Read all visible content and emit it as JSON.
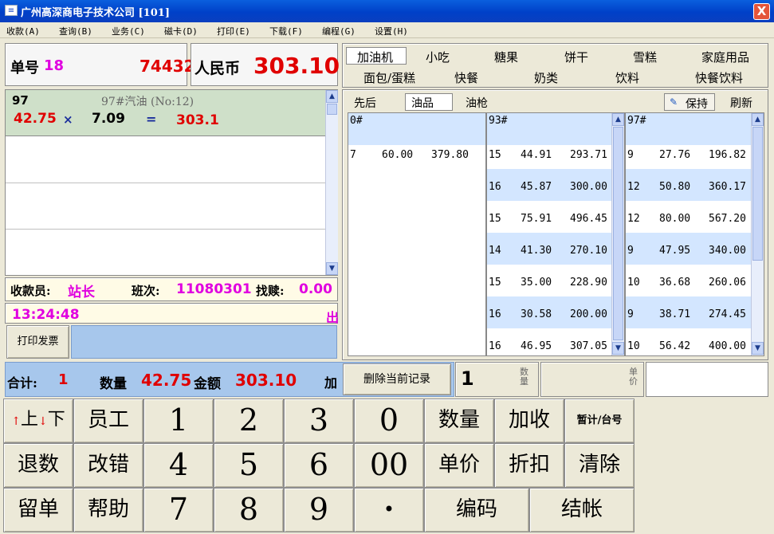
{
  "window": {
    "title": "广州高深商电子技术公司 [101]",
    "close": "X"
  },
  "menu": [
    "收款(A)",
    "查询(B)",
    "业务(C)",
    "磁卡(D)",
    "打印(E)",
    "下载(F)",
    "编程(G)",
    "设置(H)"
  ],
  "order": {
    "no_label": "单号",
    "no_value": "18",
    "code": "74432",
    "currency_label": "人民币",
    "total": "303.10"
  },
  "current_item": {
    "pump": "97",
    "desc": "97#汽油 (No:12)",
    "qty": "42.75",
    "op_times": "×",
    "price": "7.09",
    "op_eq": "=",
    "amount": "303.1"
  },
  "status": {
    "cashier_label": "收款员:",
    "cashier": "站长",
    "shift_label": "班次:",
    "shift": "11080301",
    "change_label": "找赎:",
    "change": "0.00",
    "time": "13:24:48",
    "out": "出"
  },
  "print_invoice": "打印发票",
  "categories": {
    "row1": [
      "加油机",
      "小吃",
      "糖果",
      "饼干",
      "雪糕",
      "家庭用品"
    ],
    "row2": [
      "面包/蛋糕",
      "快餐",
      "奶类",
      "饮料",
      "快餐饮料"
    ]
  },
  "subtabs": [
    "先后",
    "油品",
    "油枪"
  ],
  "hold": "保持",
  "refresh": "刷新",
  "lists": [
    {
      "header": "0#",
      "rows": [
        [
          "7",
          "60.00",
          "379.80"
        ]
      ]
    },
    {
      "header": "93#",
      "rows": [
        [
          "15",
          "44.91",
          "293.71"
        ],
        [
          "16",
          "45.87",
          "300.00"
        ],
        [
          "15",
          "75.91",
          "496.45"
        ],
        [
          "14",
          "41.30",
          "270.10"
        ],
        [
          "15",
          "35.00",
          "228.90"
        ],
        [
          "16",
          "30.58",
          "200.00"
        ],
        [
          "16",
          "46.95",
          "307.05"
        ]
      ]
    },
    {
      "header": "97#",
      "rows": [
        [
          "9",
          "27.76",
          "196.82"
        ],
        [
          "12",
          "50.80",
          "360.17"
        ],
        [
          "12",
          "80.00",
          "567.20"
        ],
        [
          "9",
          "47.95",
          "340.00"
        ],
        [
          "10",
          "36.68",
          "260.06"
        ],
        [
          "9",
          "38.71",
          "274.45"
        ],
        [
          "10",
          "56.42",
          "400.00"
        ]
      ]
    }
  ],
  "summary": {
    "total_label": "合计:",
    "total_count": "1",
    "qty_label": "数量",
    "qty": "42.75",
    "amount_label": "金额",
    "amount": "303.10",
    "extra_label": "加"
  },
  "delete_record": "删除当前记录",
  "entry": {
    "value": "1",
    "qty_label": "数量",
    "price_label": "单价"
  },
  "keypad": {
    "up": "上",
    "down": "下",
    "staff": "员工",
    "k1": "1",
    "k2": "2",
    "k3": "3",
    "k0": "0",
    "qty": "数量",
    "surcharge": "加收",
    "subtotal": "暂计/台号",
    "return": "退数",
    "correct": "改错",
    "k4": "4",
    "k5": "5",
    "k6": "6",
    "k00": "00",
    "price": "单价",
    "discount": "折扣",
    "clear": "清除",
    "hold": "留单",
    "help": "帮助",
    "k7": "7",
    "k8": "8",
    "k9": "9",
    "dot": "•",
    "code": "编码",
    "checkout": "结帐"
  }
}
